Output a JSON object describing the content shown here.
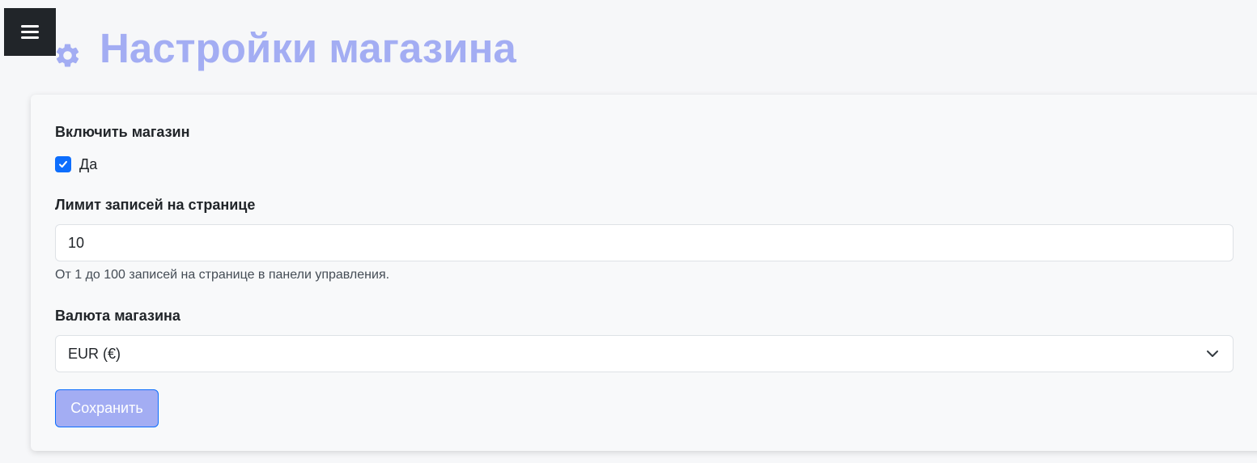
{
  "header": {
    "title": "Настройки магазина",
    "menu_icon": "hamburger-menu-icon",
    "title_icon": "gear-icon"
  },
  "form": {
    "enable_shop": {
      "label": "Включить магазин",
      "checkbox_label": "Да",
      "checked": true
    },
    "page_limit": {
      "label": "Лимит записей на странице",
      "value": "10",
      "help": "От 1 до 100 записей на странице в панели управления."
    },
    "currency": {
      "label": "Валюта магазина",
      "selected": "EUR (€)"
    },
    "save_label": "Сохранить"
  },
  "colors": {
    "accent": "#a3adf3",
    "checkbox": "#0d6efd",
    "menu_button": "#212529",
    "page_background": "#f6f7f9"
  }
}
